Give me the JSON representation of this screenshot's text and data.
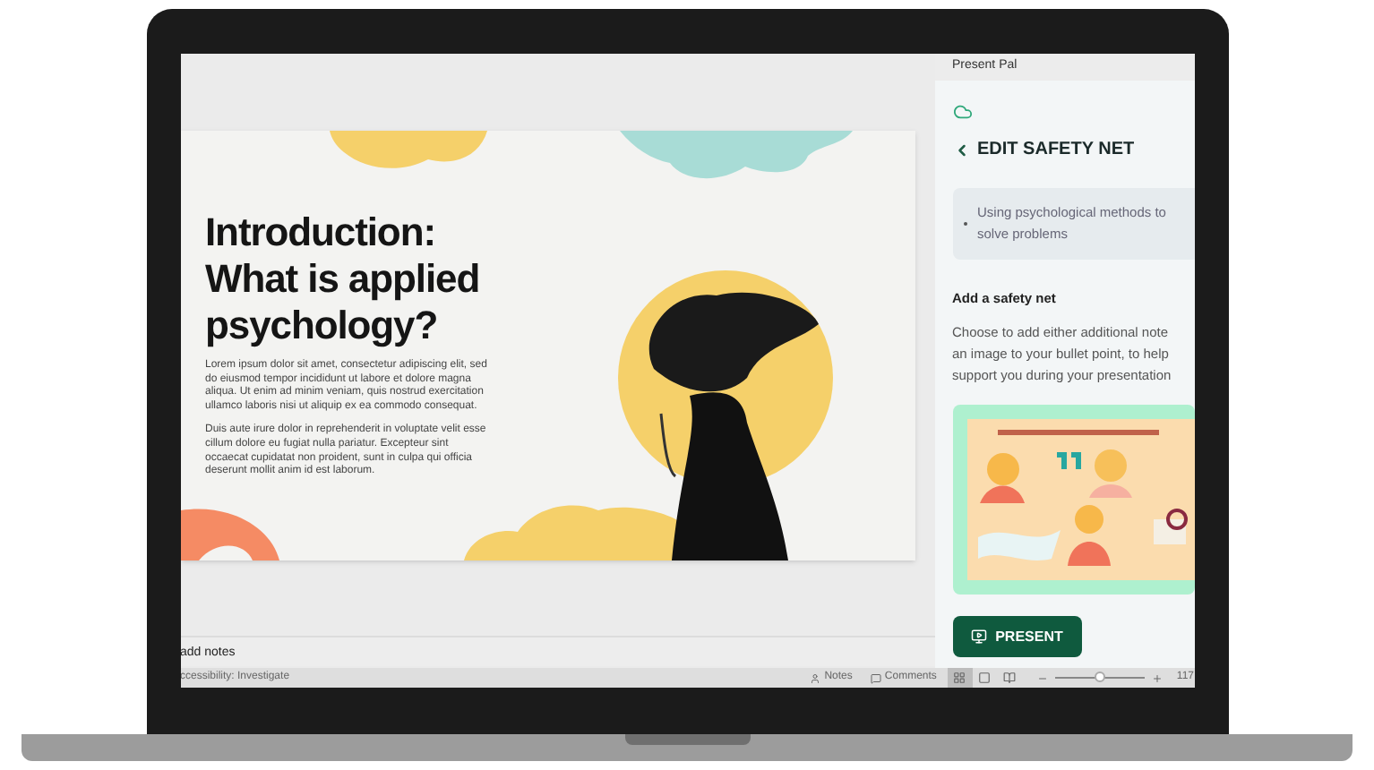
{
  "slide": {
    "title_lines": [
      "Introduction:",
      "What is applied",
      "psychology?"
    ],
    "paragraphs": [
      "Lorem ipsum dolor sit amet, consectetur adipiscing elit, sed do eiusmod tempor incididunt ut labore et dolore magna aliqua. Ut enim ad minim veniam, quis nostrud exercitation ullamco laboris nisi ut aliquip ex ea commodo consequat.",
      "Duis aute irure dolor in reprehenderit in voluptate velit esse cillum dolore eu fugiat nulla pariatur. Excepteur sint occaecat cupidatat non proident, sunt in culpa qui officia deserunt mollit anim id est laborum."
    ]
  },
  "notes": {
    "placeholder": "add notes"
  },
  "panel": {
    "app_title": "Present Pal",
    "heading": "EDIT SAFETY NET",
    "bullet": "Using psychological methods to solve problems",
    "section_title": "Add a safety net",
    "description_lines": [
      "Choose to add either additional note",
      "an image to your bullet point, to help",
      "support you during your presentation"
    ],
    "present_button": "PRESENT"
  },
  "status_bar": {
    "accessibility": "ccessibility: Investigate",
    "notes": "Notes",
    "comments": "Comments",
    "views": [
      {
        "selected": true
      },
      {
        "selected": false
      },
      {
        "selected": false
      }
    ],
    "zoom": {
      "level": 0.5,
      "reading": "117"
    }
  }
}
